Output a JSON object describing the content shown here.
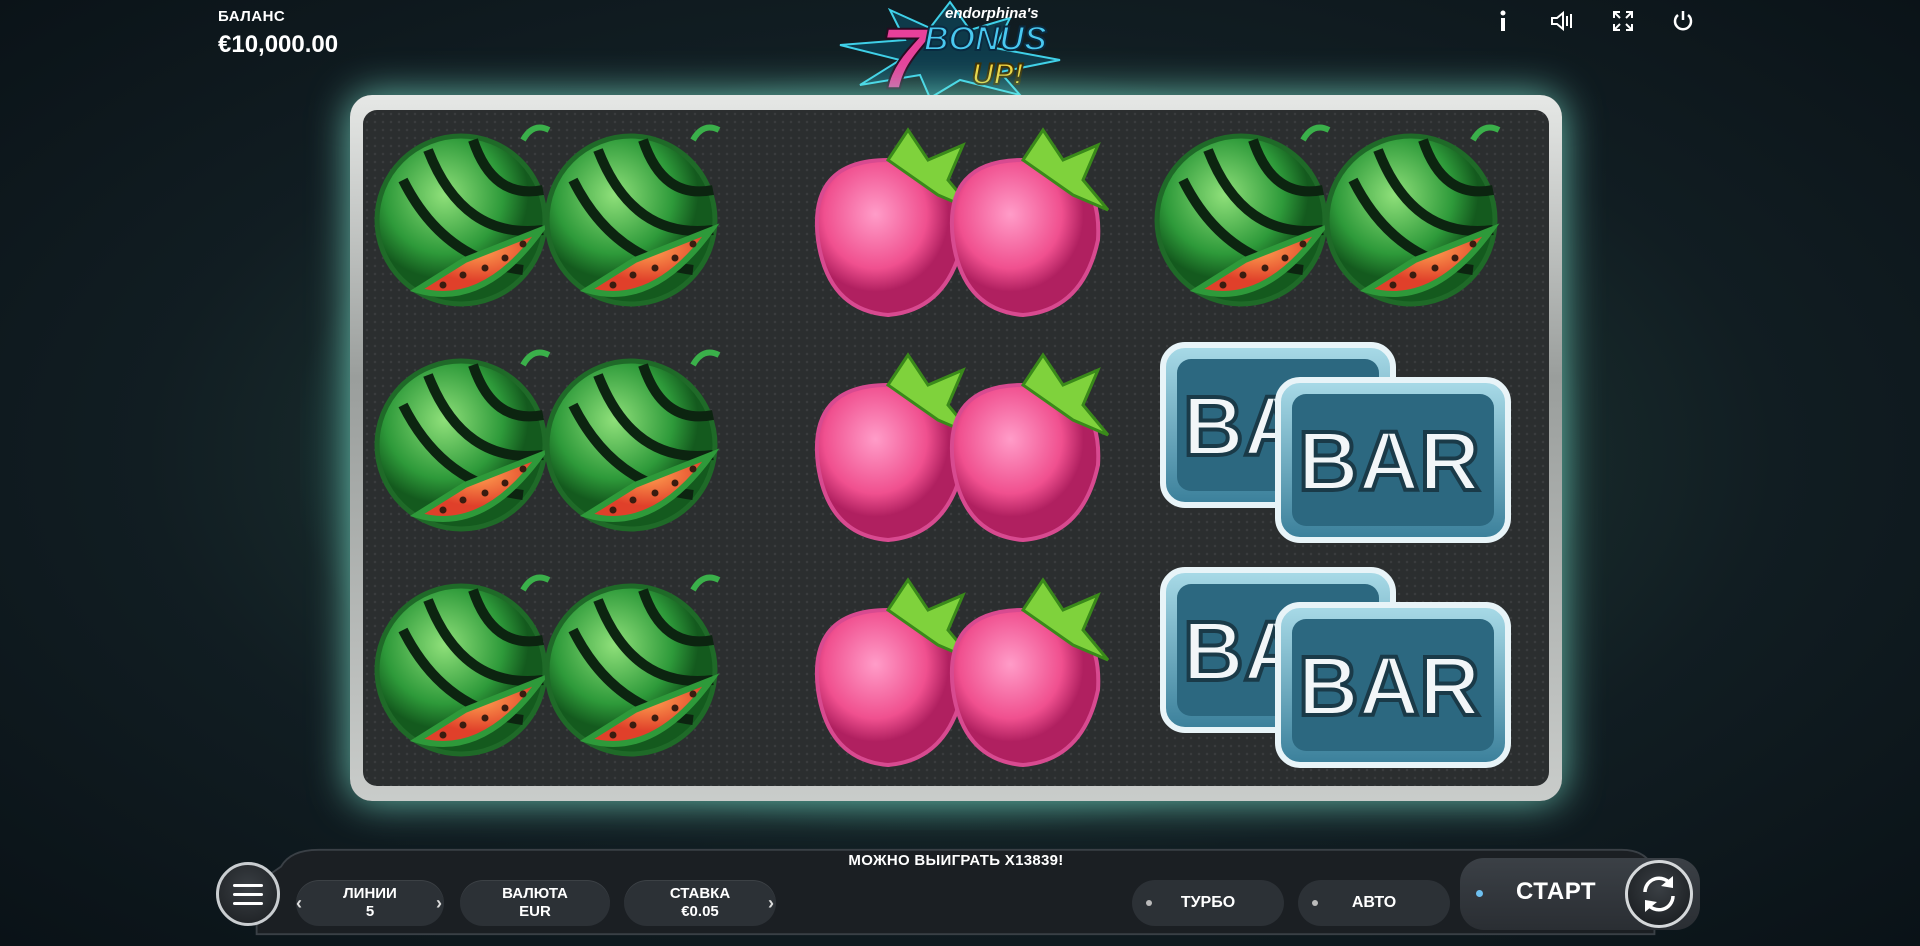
{
  "header": {
    "balance_label": "БАЛАНС",
    "balance_value": "€10,000.00",
    "logo": {
      "brand": "endorphina's",
      "number": "7",
      "word1": "BONUS",
      "word2": "UP!"
    },
    "icons": [
      "info-icon",
      "sound-icon",
      "fullscreen-icon",
      "power-icon"
    ]
  },
  "reels": {
    "columns": [
      [
        "watermelon",
        "watermelon",
        "watermelon"
      ],
      [
        "raspberry",
        "raspberry",
        "raspberry"
      ],
      [
        "watermelon",
        "bar",
        "bar"
      ]
    ],
    "bar_text": "BAR"
  },
  "controls": {
    "win_text": "МОЖНО ВЫИГРАТЬ X13839!",
    "lines_label": "ЛИНИИ",
    "lines_value": "5",
    "currency_label": "ВАЛЮТА",
    "currency_value": "EUR",
    "bet_label": "СТАВКА",
    "bet_value": "€0.05",
    "turbo_label": "ТУРБО",
    "auto_label": "АВТО",
    "start_label": "СТАРТ"
  },
  "colors": {
    "glow": "#5af0d2",
    "watermelon_rind": "#2e9a3a",
    "watermelon_flesh": "#f05a3a",
    "raspberry": "#f06ca8",
    "bar_plate": "#4a9ab8",
    "start_dot": "#6ec0f0"
  }
}
